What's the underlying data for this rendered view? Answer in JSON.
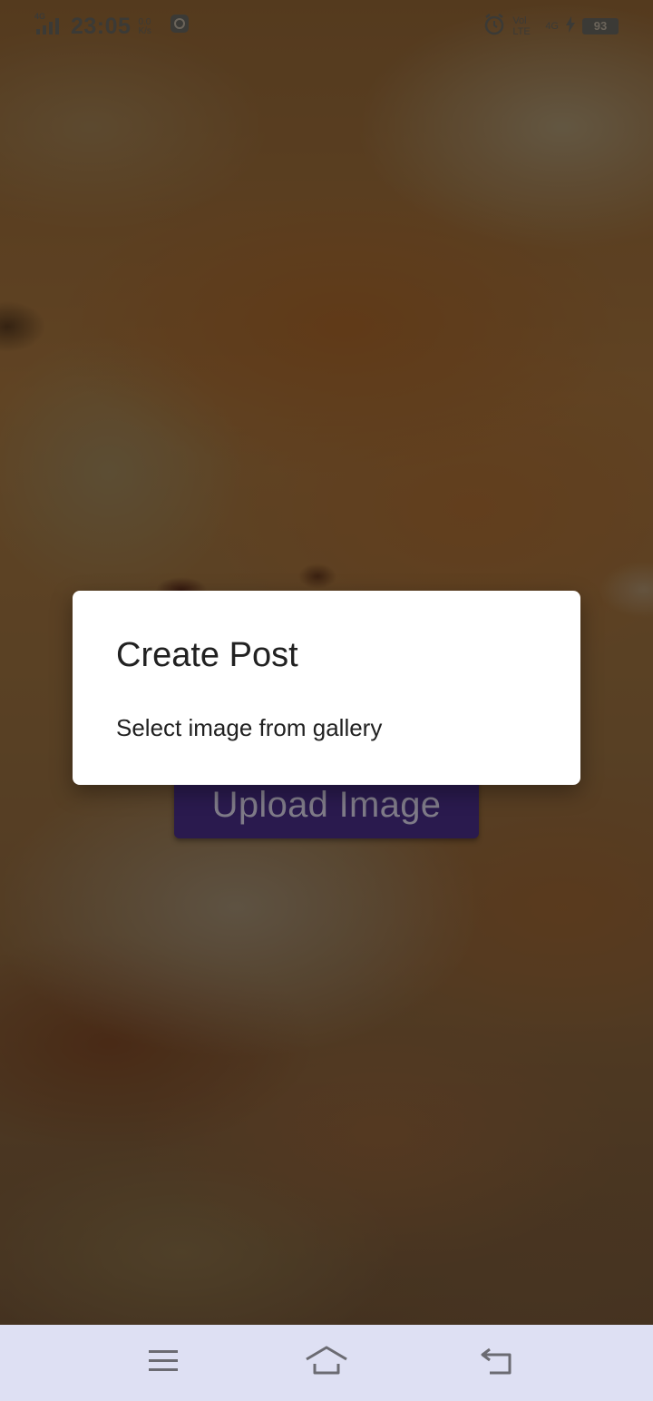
{
  "status_bar": {
    "network": "4G",
    "time": "23:05",
    "speed": "0.0 K/s",
    "volte": "Vol LTE",
    "network_right": "4G",
    "battery": "93"
  },
  "background_button": {
    "label": "Upload Image"
  },
  "dialog": {
    "title": "Create Post",
    "option": "Select image from gallery"
  },
  "nav_bar": {
    "buttons": [
      "menu-icon",
      "home-icon",
      "back-icon"
    ]
  },
  "colors": {
    "dialog_bg": "#ffffff",
    "upload_button_bg": "#2a1a4e",
    "nav_bar_bg": "#dee0f3",
    "scrim": "rgba(0,0,0,0.52)"
  }
}
